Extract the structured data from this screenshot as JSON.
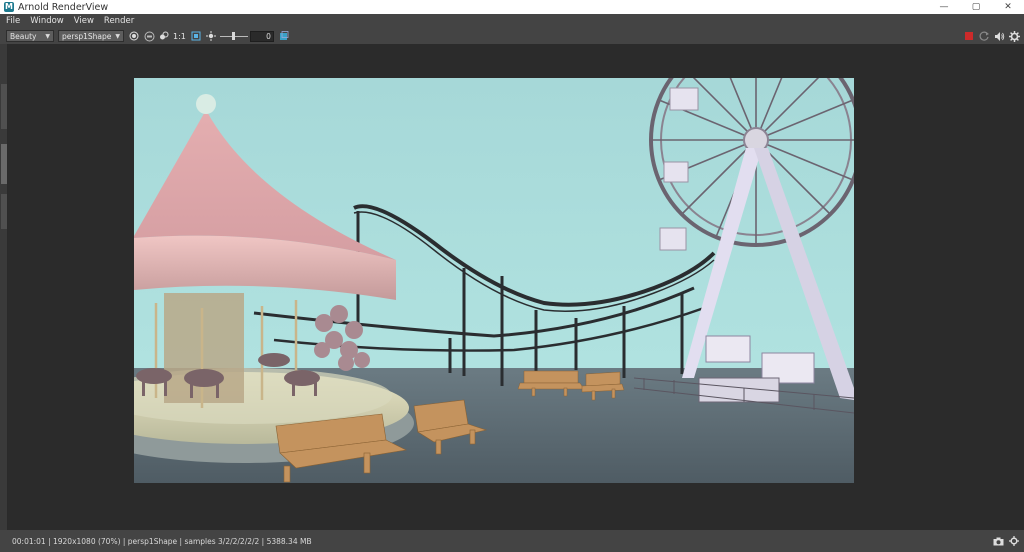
{
  "window": {
    "title": "Arnold RenderView",
    "app_icon": "M",
    "controls": [
      "minimize-icon",
      "maximize-icon",
      "close-icon"
    ],
    "control_glyphs": [
      "—",
      "▢",
      "✕"
    ]
  },
  "menu": [
    "File",
    "Window",
    "View",
    "Render"
  ],
  "toolbar": {
    "aov": "Beauty",
    "camera": "persp1Shape",
    "ratio": "1:1",
    "exposure": "0",
    "icons": [
      "display-channel-icon",
      "color-manager-icon",
      "rgba-icon",
      "region-icon",
      "exposure-icon",
      "snapshot-icon"
    ],
    "right_icons": [
      "stop-render-icon",
      "refresh-icon",
      "debug-shading-icon",
      "settings-icon"
    ],
    "stop_color": "#cc2a2a"
  },
  "render": {
    "description_colors": {
      "sky": "#a9dcdc",
      "ground": "#5c6b74",
      "carousel": "#e6b8b8",
      "ride_frame": "#2b2b2b",
      "wheel": "#d9d7e6"
    }
  },
  "status": {
    "text": "00:01:01 | 1920x1080 (70%) | persp1Shape  | samples 3/2/2/2/2/2 | 5388.34 MB",
    "icons": [
      "snapshot-icon",
      "settings-icon"
    ]
  }
}
